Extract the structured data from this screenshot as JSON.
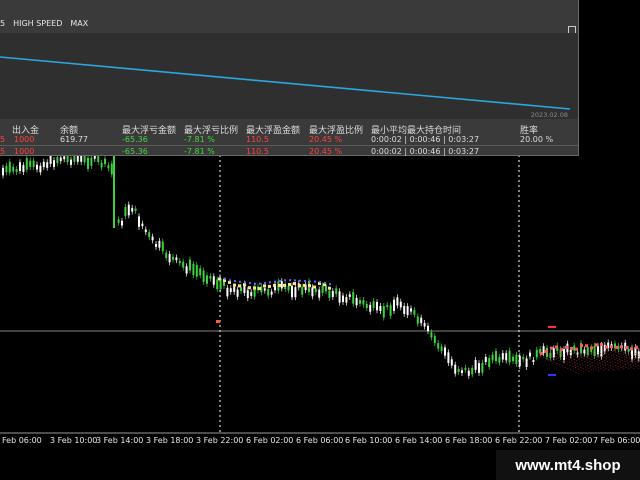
{
  "panel": {
    "mode_prefix": "5",
    "mode_high_speed": "HIGH SPEED",
    "mode_max": "MAX",
    "equity_date": "2023.02.08",
    "line_color": "#2aa6e0",
    "headers": {
      "in_out": "出入金",
      "balance": "余额",
      "max_float_loss_amt": "最大浮亏金额",
      "max_float_loss_pct": "最大浮亏比例",
      "max_float_profit_amt": "最大浮盈金额",
      "max_float_profit_pct": "最大浮盈比例",
      "hold_time": "最小平均最大持仓时间",
      "win_rate": "胜率"
    },
    "rows": [
      {
        "pre": "5",
        "in_out": "1000",
        "balance": "619.77",
        "loss_amt": "-65.36",
        "loss_pct": "-7.81 %",
        "profit_amt": "110.5",
        "profit_pct": "20.45 %",
        "hold": "0:00:02 | 0:00:46 | 0:03:27",
        "win": "20.00 %"
      },
      {
        "pre": "5",
        "in_out": "1000",
        "balance": "",
        "loss_amt": "-65.36",
        "loss_pct": "-7.81 %",
        "profit_amt": "110.5",
        "profit_pct": "20.45 %",
        "hold": "0:00:02 | 0:00:46 | 0:03:27",
        "win": ""
      }
    ]
  },
  "time_axis": [
    "Feb 06:00",
    "3 Feb 10:00",
    "3 Feb 14:00",
    "3 Feb 18:00",
    "3 Feb 22:00",
    "6 Feb 02:00",
    "6 Feb 06:00",
    "6 Feb 10:00",
    "6 Feb 14:00",
    "6 Feb 18:00",
    "6 Feb 22:00",
    "7 Feb 02:00",
    "7 Feb 06:00"
  ],
  "brand": "www.mt4.shop",
  "colors": {
    "bull": "#3cd23c",
    "bear": "#ffffff",
    "grid_dash": "#ffffff",
    "hline": "#b0b0b0"
  }
}
